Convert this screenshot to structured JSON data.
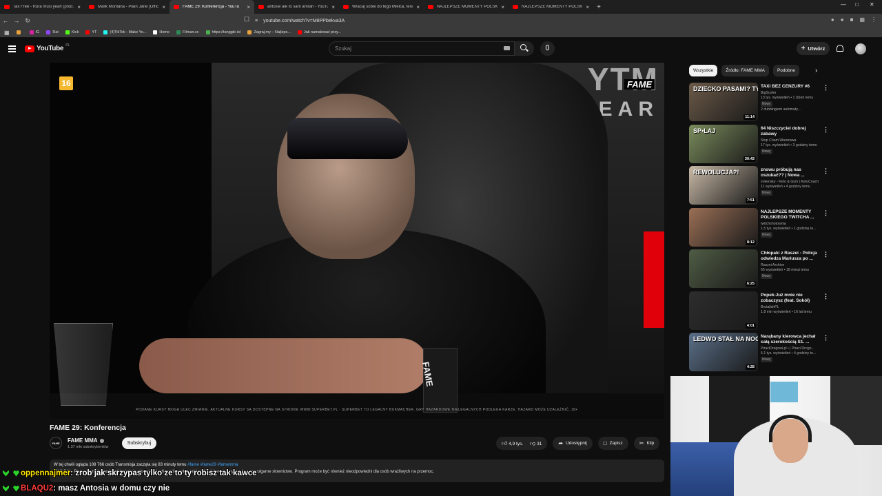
{
  "browser": {
    "tabs": [
      {
        "title": "Tax Free - Rura musi yeah (prod. CU)",
        "active": false
      },
      {
        "title": "Malik Montana - Plain Jane [Official /",
        "active": false
      },
      {
        "title": "FAME 29: Konferencja - YouTu",
        "active": true
      },
      {
        "title": "antosie ale to sam amrah - YouTube",
        "active": false
      },
      {
        "title": "Wracaj sobie do tego Mielca, teraz m",
        "active": false
      },
      {
        "title": "NAJLEPSZE MOMENTY POLSKIEGO T",
        "active": false
      },
      {
        "title": "NAJLEPSZE MOMENTY POLSKIEGO T",
        "active": false
      }
    ],
    "new_tab": "+",
    "url": "youtube.com/watch?v=M8PPbekva3A",
    "bookmarks": [
      {
        "label": "",
        "color": "#e8a33d"
      },
      {
        "label": "IG",
        "color": "#d6249f"
      },
      {
        "label": "Rat",
        "color": "#9146ff"
      },
      {
        "label": "Kick",
        "color": "#53fc18"
      },
      {
        "label": "YT",
        "color": "#ff0000"
      },
      {
        "label": "(4)TikTok - Make Yo...",
        "color": "#25f4ee"
      },
      {
        "label": "Home",
        "color": "#ffffff"
      },
      {
        "label": "Filman.cc",
        "color": "#2e8b57"
      },
      {
        "label": "https://tanggle.io/",
        "color": "#4caf50"
      },
      {
        "label": "Zagraj.my – Najleps...",
        "color": "#e8a33d"
      },
      {
        "label": "Jak namalować przy...",
        "color": "#ff0000"
      }
    ]
  },
  "header": {
    "logo": "YouTube",
    "region": "PL",
    "search_placeholder": "Szukaj",
    "create_label": "Utwórz"
  },
  "player": {
    "age_rating": "16",
    "brand_logo": "FAME",
    "banner_line1": "YTM",
    "banner_line2": "WEAR",
    "mic_label": "FAME",
    "disclaimer": "PODANE KURSY MOGĄ ULEC ZMIANIE. AKTUALNE KURSY SĄ DOSTĘPNE NA STRONIE WWW.SUPERBET.PL · SUPERBET TO LEGALNY BUKMACHER. GRY HAZARDOWE NIELEGALNYCH PODLEGA KARZE. HAZARD MOŻE UZALEŻNIĆ. 18+"
  },
  "video": {
    "title": "FAME 29: Konferencja",
    "channel": "FAME MMA",
    "channel_avatar_text": "FAME",
    "subscribers": "1,37 mln subskrybentów",
    "subscribe_label": "Subskrybuj",
    "likes": "4,9 tys.",
    "dislikes": "31",
    "share_label": "Udostępnij",
    "save_label": "Zapisz",
    "clip_label": "Klip",
    "description_stats": "W tej chwili ogląda 108 766 osób  Transmisja zaczęła się 83 minuty temu",
    "description_tags": "#fame #fame29 #famemma",
    "description_body": "UWAGA! · Program może zawierać treści nieodpowiednie dla osób małoletnich, takie jak wulgarny język oraz wulgarne słownictwo. Program może być również nieodpowiedni dla osób wrażliwych na przemoc."
  },
  "chat": [
    {
      "user": "oppennajmer",
      "message": ": zrob jak skrzypas tylko ze to ty robisz tak kawce",
      "color": "#ffe600"
    },
    {
      "user": "BLAQU2",
      "message": ": masz Antosia w domu czy nie",
      "color": "#ff3b3b"
    }
  ],
  "sidebar": {
    "chips": [
      {
        "label": "Wszystkie",
        "active": true
      },
      {
        "label": "Źródło: FAME MMA",
        "active": false
      },
      {
        "label": "Podobne",
        "active": false
      }
    ],
    "recommendations": [
      {
        "title": "TAXI BEZ CENZURY #6",
        "channel": "BigScofer",
        "meta": "13 tys. wyświetleń • 1 dzień temu",
        "badge": "Nowy",
        "extra": "2 dubbingiem automaty...",
        "duration": "11:14",
        "caption": "DZIECKO PASAMI? TY KUR...",
        "thumb": "#6b5a48"
      },
      {
        "title": "64 Niszczyciel dobrej zabawy",
        "channel": "Stop Cham Warszawa",
        "meta": "17 tys. wyświetleń • 3 godziny temu",
        "badge": "Nowy",
        "extra": "",
        "duration": "30:43",
        "caption": "SP•LAJ",
        "thumb": "#7b8c5c"
      },
      {
        "title": "znowu próbują nas oszukać?? | Nowa ...",
        "channel": "vokensky - Keto & Gym | KetoCoach",
        "meta": "11 wyświetleń • 4 godziny temu",
        "badge": "Nowy",
        "extra": "",
        "duration": "7:51",
        "caption": "REWOLUCJA?!",
        "thumb": "#c8b9a6"
      },
      {
        "title": "NAJLEPSZE MOMENTY POLSKIEGO TWITCHA ...",
        "channel": "twitchshotownia",
        "meta": "1,5 tys. wyświetleń • 1 godzinę te...",
        "badge": "Nowy",
        "extra": "",
        "duration": "8:12",
        "caption": "",
        "thumb": "#9a6f55"
      },
      {
        "title": "Chłopaki z Raszei - Policja odwiedza Mariusza po ...",
        "channel": "Raszei Archive",
        "meta": "65 wyświetleń • 18 minut temu",
        "badge": "Nowy",
        "extra": "",
        "duration": "6:25",
        "caption": "",
        "thumb": "#4f5c44"
      },
      {
        "title": "Popek-Już mnie nie zobaczysz (feat. Sokół)",
        "channel": "BrutalishPL",
        "meta": "1,8 mln wyświetleń • 16 lat temu",
        "badge": "",
        "extra": "",
        "duration": "4:01",
        "caption": "",
        "thumb": "#2d2d2d"
      },
      {
        "title": "Narąbany kierowca jechał całą szerokością S1. ...",
        "channel": "PiraciDrogowi.pl • | Piraci Drogo...",
        "meta": "5,1 tys. wyświetleń • 4 godziny te...",
        "badge": "Nowy",
        "extra": "",
        "duration": "4:28",
        "caption": "LEDWO STAŁ NA NOGACH",
        "thumb": "#5a6f88"
      }
    ]
  }
}
